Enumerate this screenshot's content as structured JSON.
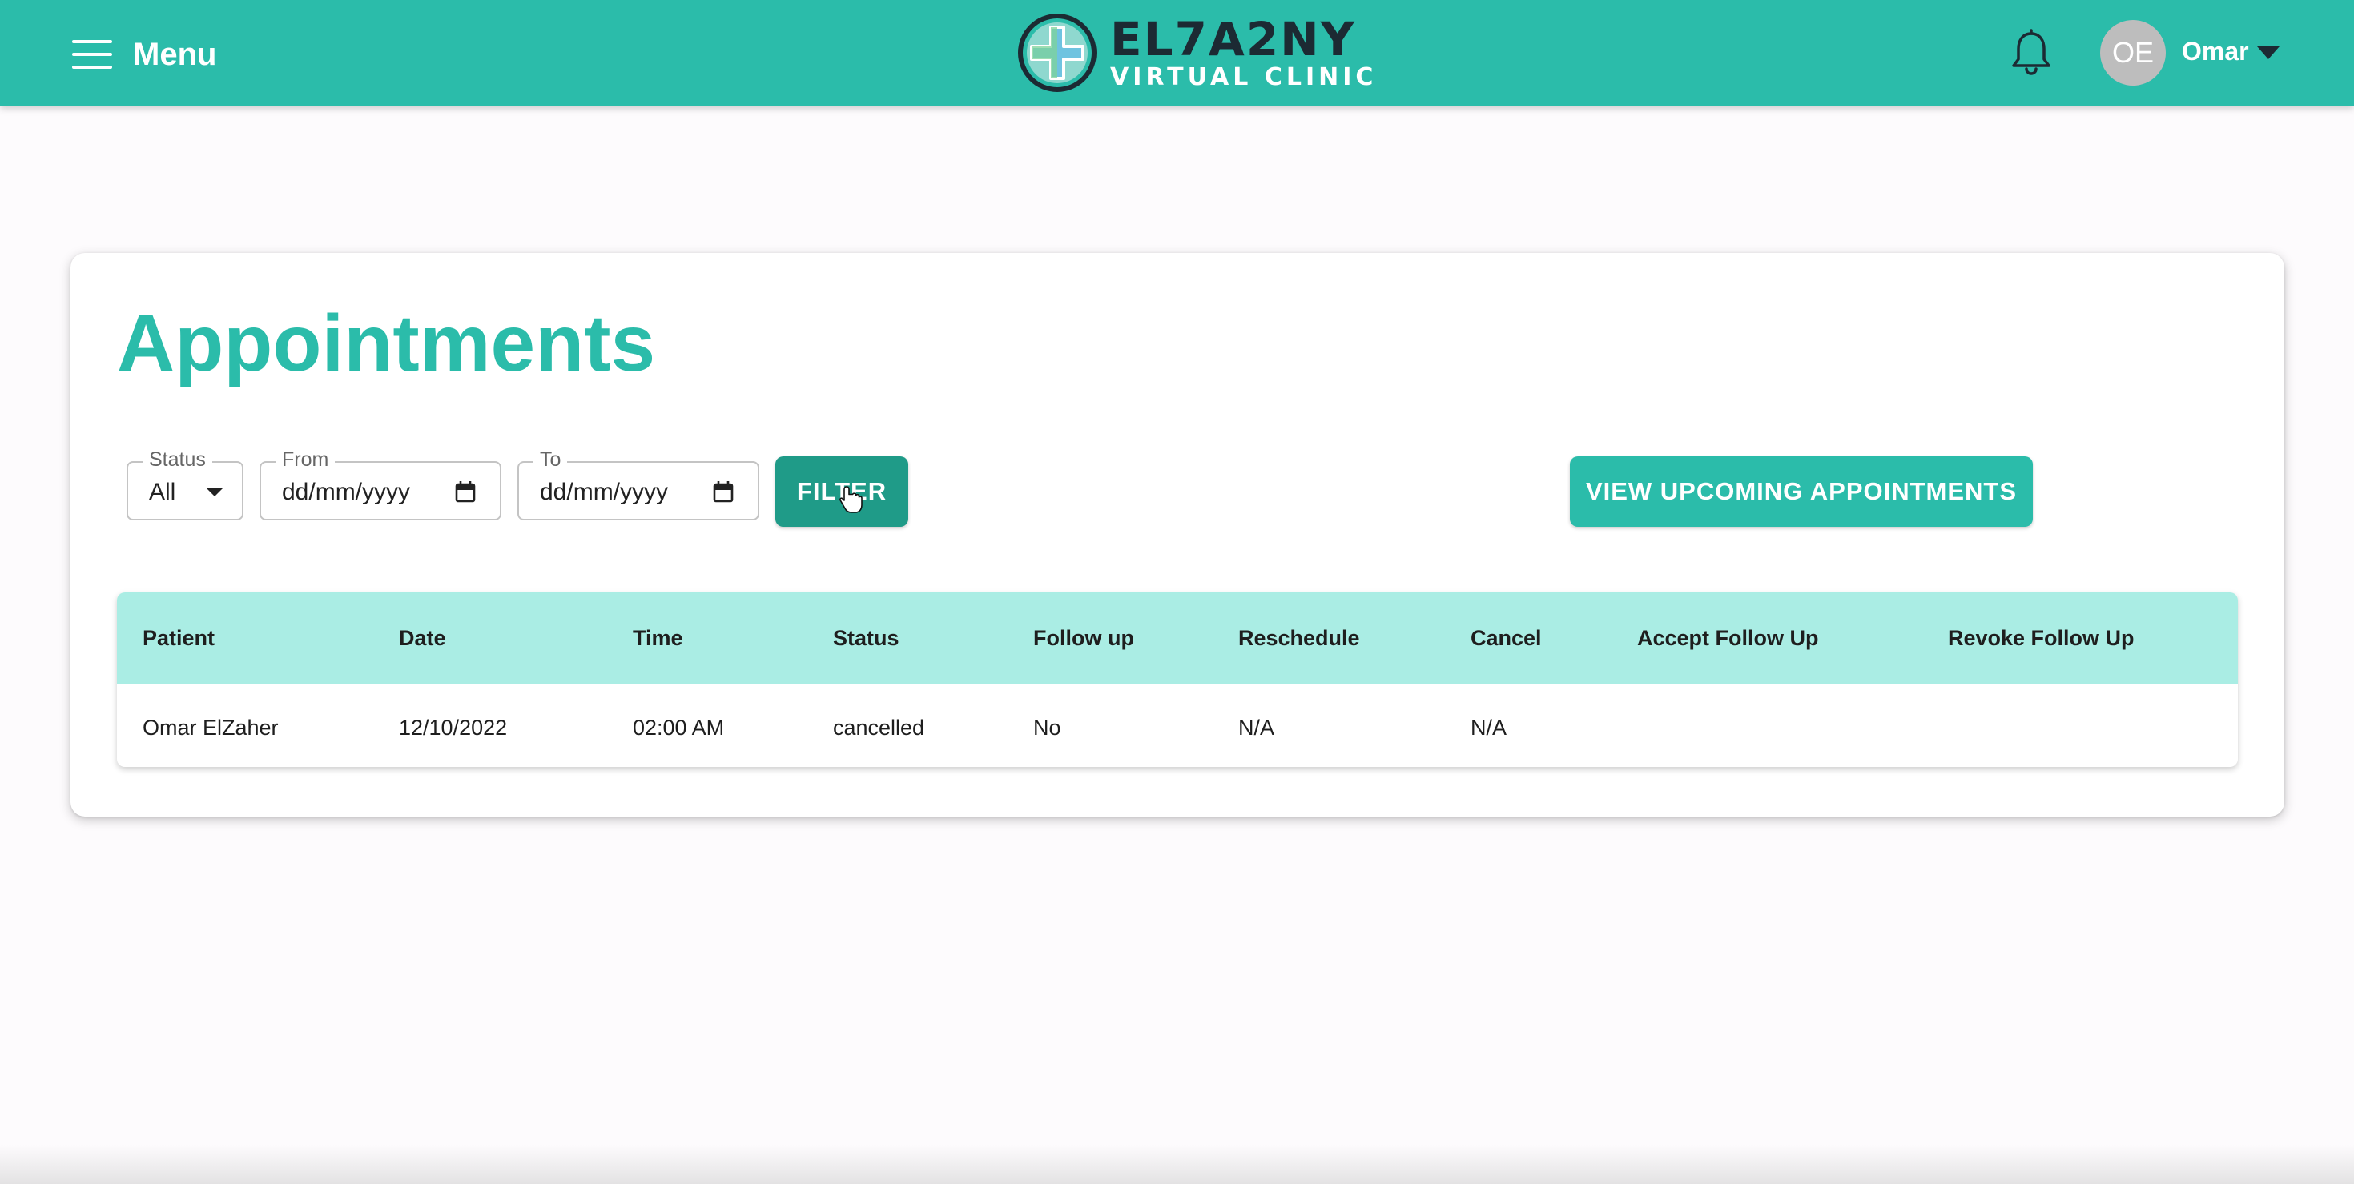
{
  "header": {
    "menu_label": "Menu",
    "logo_title": "EL7A2NY",
    "logo_subtitle": "VIRTUAL CLINIC",
    "user_initials": "OE",
    "user_name": "Omar",
    "brand_color": "#2bbcaa"
  },
  "page": {
    "title": "Appointments"
  },
  "filters": {
    "status": {
      "label": "Status",
      "value": "All"
    },
    "from": {
      "label": "From",
      "value": "dd/mm/yyyy"
    },
    "to": {
      "label": "To",
      "value": "dd/mm/yyyy"
    },
    "filter_button": "FILTER",
    "upcoming_button": "VIEW UPCOMING APPOINTMENTS"
  },
  "table": {
    "headers": [
      "Patient",
      "Date",
      "Time",
      "Status",
      "Follow up",
      "Reschedule",
      "Cancel",
      "Accept Follow Up",
      "Revoke Follow Up"
    ],
    "rows": [
      [
        "Omar ElZaher",
        "12/10/2022",
        "02:00 AM",
        "cancelled",
        "No",
        "N/A",
        "N/A",
        "",
        ""
      ]
    ],
    "header_color": "#aaede4"
  },
  "icons": {
    "menu": "hamburger-icon",
    "notifications": "bell-icon",
    "account_dropdown": "caret-down-icon",
    "date_picker": "calendar-icon"
  }
}
